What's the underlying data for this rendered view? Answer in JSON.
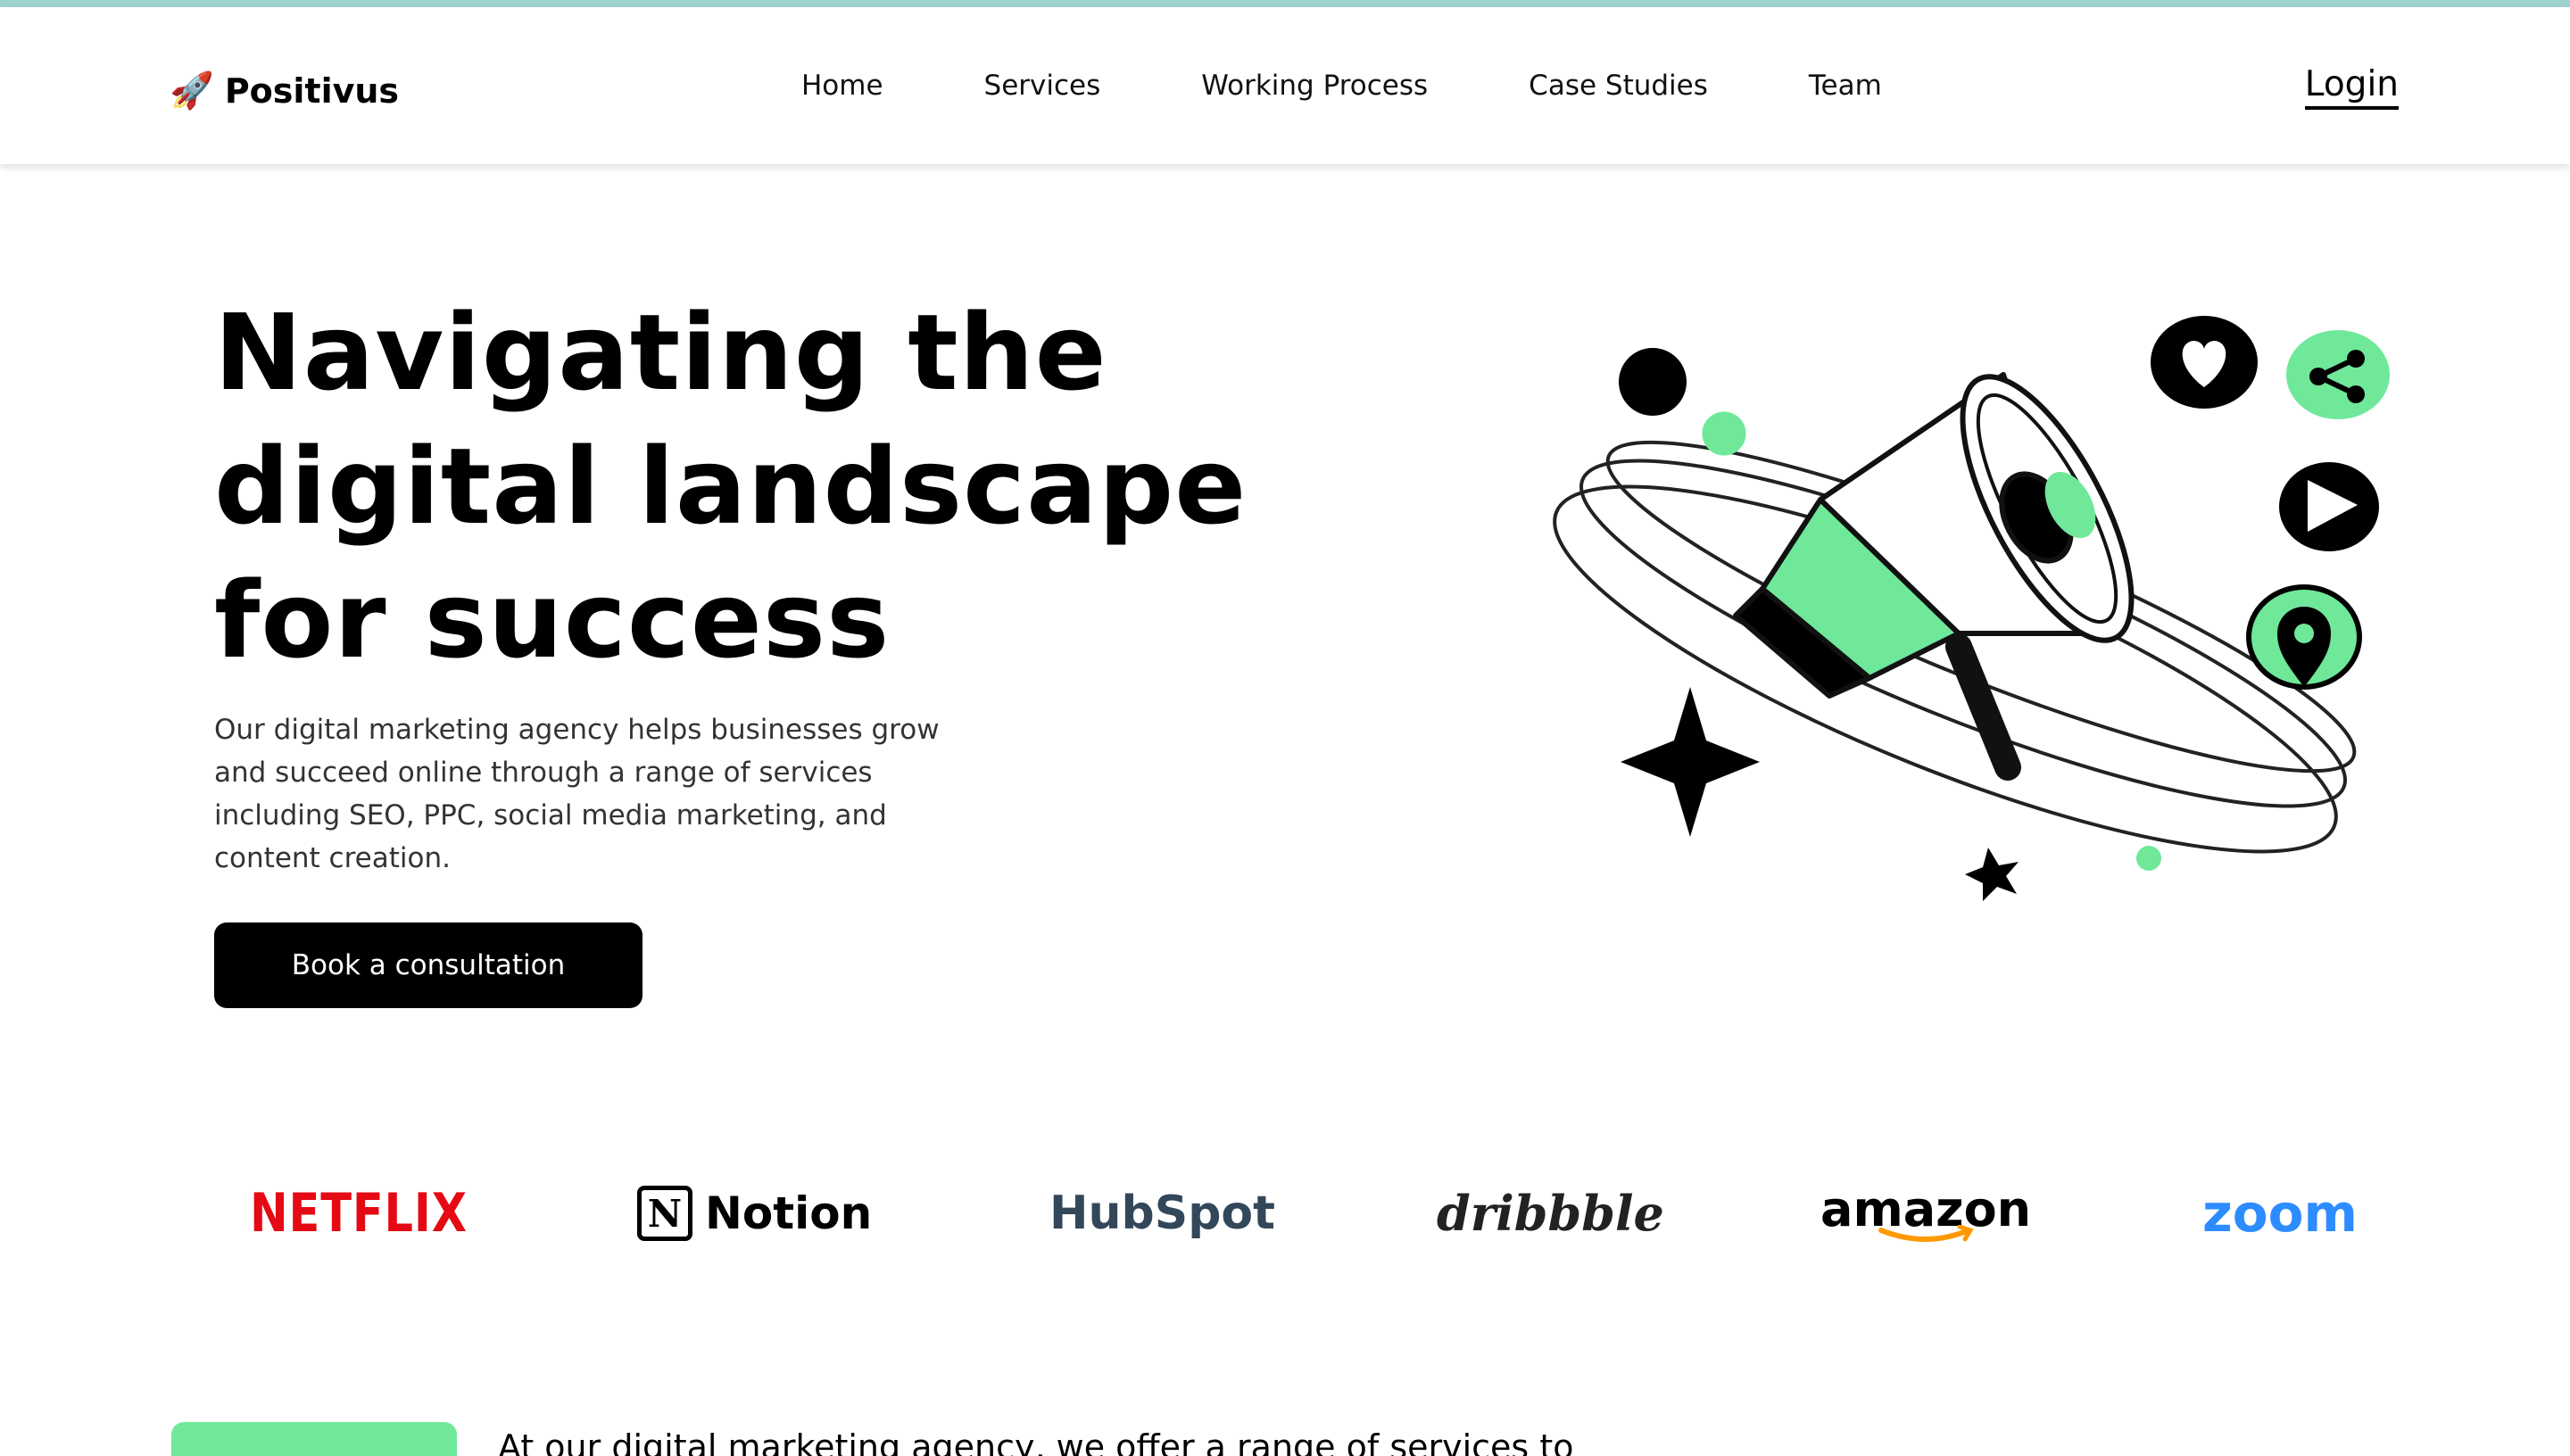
{
  "nav": {
    "brand": "Positivus",
    "items": [
      "Home",
      "Services",
      "Working Process",
      "Case Studies",
      "Team"
    ],
    "login": "Login"
  },
  "hero": {
    "title_lines": [
      "Navigating the",
      "digital landscape",
      "for success"
    ],
    "description": "Our digital marketing agency helps businesses grow and succeed online through a range of services including SEO, PPC, social media marketing, and content creation.",
    "cta": "Book a consultation"
  },
  "clients": [
    "NETFLIX",
    "Notion",
    "HubSpot",
    "dribbble",
    "amazon",
    "zoom"
  ],
  "services_intro": {
    "text": "At our digital marketing agency, we offer a range of services to"
  },
  "colors": {
    "accent": "#6fe89a",
    "dark": "#000000",
    "topline": "#9fd3cf"
  },
  "icons": [
    "rocket-icon",
    "megaphone-illustration",
    "heart-icon",
    "share-icon",
    "play-icon",
    "location-icon",
    "sparkle-icon"
  ]
}
